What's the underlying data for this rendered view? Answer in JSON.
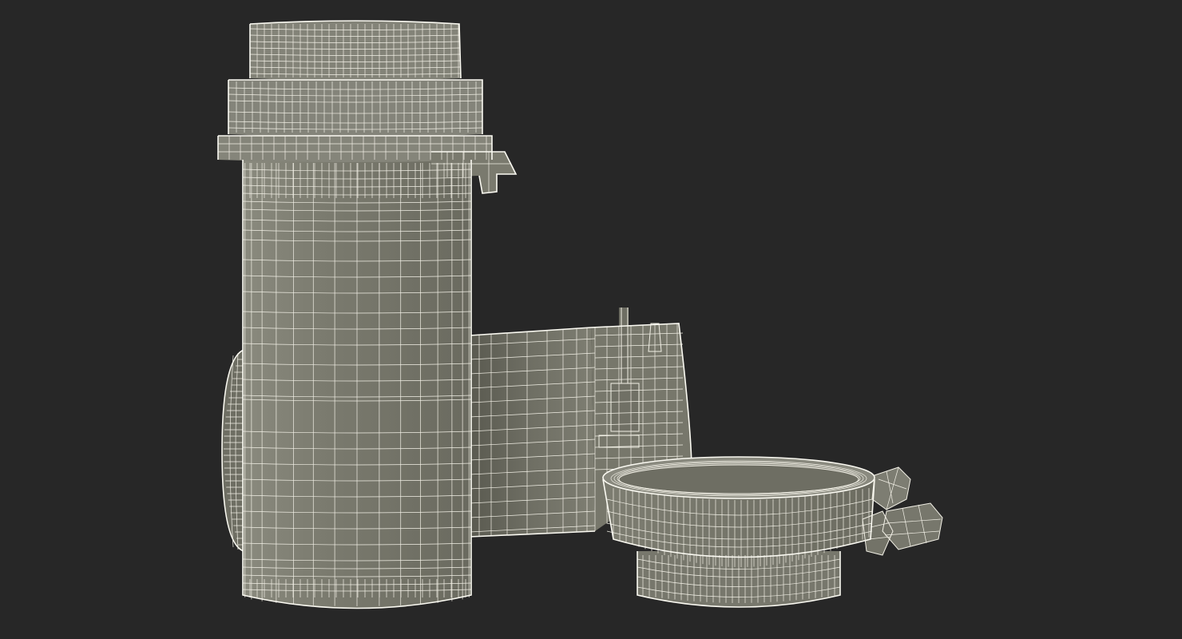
{
  "scene": {
    "background_color": "#272727",
    "mesh_fill_color": "#7c7c70",
    "mesh_shadow_color": "#5a5a50",
    "wireframe_color": "#f2f0e6",
    "render_mode": "wireframe-on-shaded",
    "objects": [
      {
        "name": "tall-cylinder-body"
      },
      {
        "name": "horizontal-pipe-section"
      },
      {
        "name": "flanged-lid-cap"
      }
    ]
  }
}
